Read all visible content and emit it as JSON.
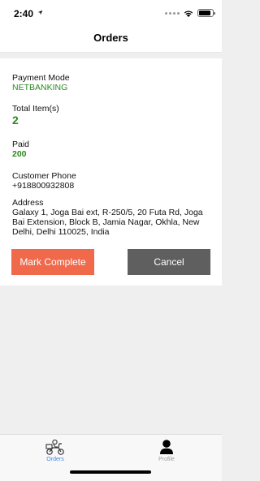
{
  "status_bar": {
    "time": "2:40",
    "battery_level": 0.9
  },
  "header": {
    "title": "Orders"
  },
  "order": {
    "payment_mode_label": "Payment Mode",
    "payment_mode_value": "NETBANKING",
    "total_items_label": "Total Item(s)",
    "total_items_value": "2",
    "paid_label": "Paid",
    "paid_value": "200",
    "customer_phone_label": "Customer Phone",
    "customer_phone_value": "+918800932808",
    "address_label": "Address",
    "address_value": "Galaxy 1, Joga Bai ext, R-250/5, 20 Futa Rd, Joga Bai Extension, Block B, Jamia Nagar, Okhla, New Delhi, Delhi 110025, India"
  },
  "actions": {
    "mark_complete_label": "Mark Complete",
    "cancel_label": "Cancel"
  },
  "tabs": [
    {
      "label": "Orders",
      "icon": "delivery-scooter-icon",
      "active": true
    },
    {
      "label": "Profile",
      "icon": "person-icon",
      "active": false
    }
  ],
  "colors": {
    "accent_green": "#2a8a1e",
    "mark_complete_bg": "#f0694a",
    "cancel_bg": "#5f5f5f",
    "active_tab": "#3b82f6"
  }
}
